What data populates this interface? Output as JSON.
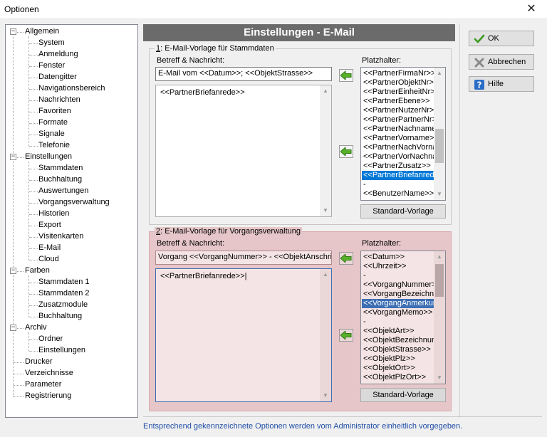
{
  "window": {
    "title": "Optionen",
    "close_glyph": "✕"
  },
  "tree": [
    {
      "label": "Allgemein",
      "level": 0,
      "expanded": true
    },
    {
      "label": "System",
      "level": 1
    },
    {
      "label": "Anmeldung",
      "level": 1
    },
    {
      "label": "Fenster",
      "level": 1
    },
    {
      "label": "Datengitter",
      "level": 1
    },
    {
      "label": "Navigationsbereich",
      "level": 1
    },
    {
      "label": "Nachrichten",
      "level": 1
    },
    {
      "label": "Favoriten",
      "level": 1
    },
    {
      "label": "Formate",
      "level": 1
    },
    {
      "label": "Signale",
      "level": 1
    },
    {
      "label": "Telefonie",
      "level": 1
    },
    {
      "label": "Einstellungen",
      "level": 0,
      "expanded": true
    },
    {
      "label": "Stammdaten",
      "level": 1
    },
    {
      "label": "Buchhaltung",
      "level": 1
    },
    {
      "label": "Auswertungen",
      "level": 1
    },
    {
      "label": "Vorgangsverwaltung",
      "level": 1
    },
    {
      "label": "Historien",
      "level": 1
    },
    {
      "label": "Export",
      "level": 1
    },
    {
      "label": "Visitenkarten",
      "level": 1
    },
    {
      "label": "E-Mail",
      "level": 1
    },
    {
      "label": "Cloud",
      "level": 1
    },
    {
      "label": "Farben",
      "level": 0,
      "expanded": true
    },
    {
      "label": "Stammdaten 1",
      "level": 1
    },
    {
      "label": "Stammdaten 2",
      "level": 1
    },
    {
      "label": "Zusatzmodule",
      "level": 1
    },
    {
      "label": "Buchhaltung",
      "level": 1
    },
    {
      "label": "Archiv",
      "level": 0,
      "expanded": true
    },
    {
      "label": "Ordner",
      "level": 1
    },
    {
      "label": "Einstellungen",
      "level": 1
    },
    {
      "label": "Drucker",
      "level": 0
    },
    {
      "label": "Verzeichnisse",
      "level": 0
    },
    {
      "label": "Parameter",
      "level": 0
    },
    {
      "label": "Registrierung",
      "level": 0
    }
  ],
  "header": {
    "title": "Einstellungen - E-Mail"
  },
  "section1": {
    "title_num": "1",
    "title_rest": ": E-Mail-Vorlage für Stammdaten",
    "betreff_label": "Betreff & Nachricht:",
    "subject": "E-Mail vom <<Datum>>; <<ObjektStrasse>>",
    "body": "<<PartnerBriefanrede>>",
    "placeholder_label": "Platzhalter:",
    "placeholders": [
      "<<PartnerFirmaNr>>",
      "<<PartnerObjektNr>>",
      "<<PartnerEinheitNr>>",
      "<<PartnerEbene>>",
      "<<PartnerNutzerNr>>",
      "<<PartnerPartnerNr>>",
      "<<PartnerNachname>>",
      "<<PartnerVorname>>",
      "<<PartnerNachVorname>>",
      "<<PartnerVorNachname>>",
      "<<PartnerZusatz>>",
      "<<PartnerBriefanrede>>",
      "-",
      "<<BenutzerName>>"
    ],
    "selected_index": 11,
    "standard_button": "Standard-Vorlage"
  },
  "section2": {
    "title_num": "2",
    "title_rest": ": E-Mail-Vorlage für Vorgangsverwaltung",
    "betreff_label": "Betreff & Nachricht:",
    "subject": "Vorgang <<VorgangNummer>> - <<ObjektAnschrift>>",
    "body": "<<PartnerBriefanrede>>|",
    "placeholder_label": "Platzhalter:",
    "placeholders": [
      "<<Datum>>",
      "<<Uhrzeit>>",
      "-",
      "<<VorgangNummer>>",
      "<<VorgangBezeichnung>>",
      "<<VorgangAnmerkung>>",
      "<<VorgangMemo>>",
      "-",
      "<<ObjektArt>>",
      "<<ObjektBezeichnung>>",
      "<<ObjektStrasse>>",
      "<<ObjektPlz>>",
      "<<ObjektOrt>>",
      "<<ObjektPlzOrt>>"
    ],
    "selected_index": 5,
    "standard_button": "Standard-Vorlage"
  },
  "buttons": {
    "ok": "OK",
    "cancel": "Abbrechen",
    "help": "Hilfe"
  },
  "footer": {
    "text": "Entsprechend gekennzeichnete Optionen werden vom Administrator einheitlich vorgegeben."
  },
  "colors": {
    "accent": "#0078d7",
    "banner": "#6b6b6b",
    "admin_section": "#e6c6c8",
    "footer_text": "#1f4ea5"
  }
}
